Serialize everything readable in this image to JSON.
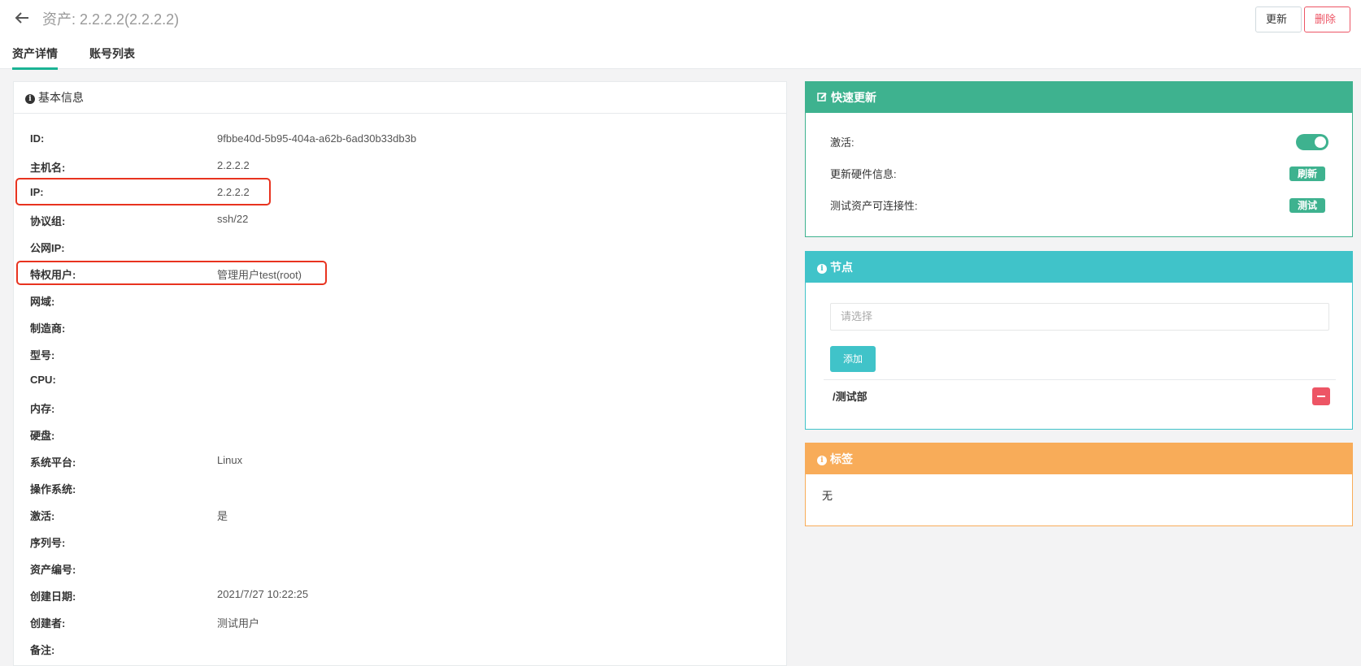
{
  "header": {
    "title": "资产: 2.2.2.2(2.2.2.2)",
    "update_label": "更新",
    "delete_label": "删除"
  },
  "tabs": [
    {
      "label": "资产详情",
      "active": true
    },
    {
      "label": "账号列表",
      "active": false
    }
  ],
  "basic_info": {
    "title": "基本信息",
    "rows": [
      {
        "label": "ID:",
        "value": "9fbbe40d-5b95-404a-a62b-6ad30b33db3b"
      },
      {
        "label": "主机名:",
        "value": "2.2.2.2"
      },
      {
        "label": "IP:",
        "value": "2.2.2.2"
      },
      {
        "label": "协议组:",
        "value": "ssh/22"
      },
      {
        "label": "公网IP:",
        "value": ""
      },
      {
        "label": "特权用户:",
        "value": "管理用户test(root)"
      },
      {
        "label": "网域:",
        "value": ""
      },
      {
        "label": "制造商:",
        "value": ""
      },
      {
        "label": "型号:",
        "value": ""
      },
      {
        "label": "CPU:",
        "value": ""
      },
      {
        "label": "内存:",
        "value": ""
      },
      {
        "label": "硬盘:",
        "value": ""
      },
      {
        "label": "系统平台:",
        "value": "Linux"
      },
      {
        "label": "操作系统:",
        "value": ""
      },
      {
        "label": "激活:",
        "value": "是"
      },
      {
        "label": "序列号:",
        "value": ""
      },
      {
        "label": "资产编号:",
        "value": ""
      },
      {
        "label": "创建日期:",
        "value": "2021/7/27 10:22:25"
      },
      {
        "label": "创建者:",
        "value": "测试用户"
      },
      {
        "label": "备注:",
        "value": ""
      }
    ]
  },
  "quick_update": {
    "title": "快速更新",
    "active_label": "激活:",
    "active_on": true,
    "hardware_label": "更新硬件信息:",
    "refresh_label": "刷新",
    "connectivity_label": "测试资产可连接性:",
    "test_label": "测试"
  },
  "nodes": {
    "title": "节点",
    "select_placeholder": "请选择",
    "add_label": "添加",
    "items": [
      "/测试部"
    ]
  },
  "tags": {
    "title": "标签",
    "value": "无"
  },
  "colors": {
    "green": "#3eb28f",
    "cyan": "#40c3c9",
    "orange": "#f8ac59",
    "red": "#ed5565",
    "highlight": "#e8331f"
  }
}
